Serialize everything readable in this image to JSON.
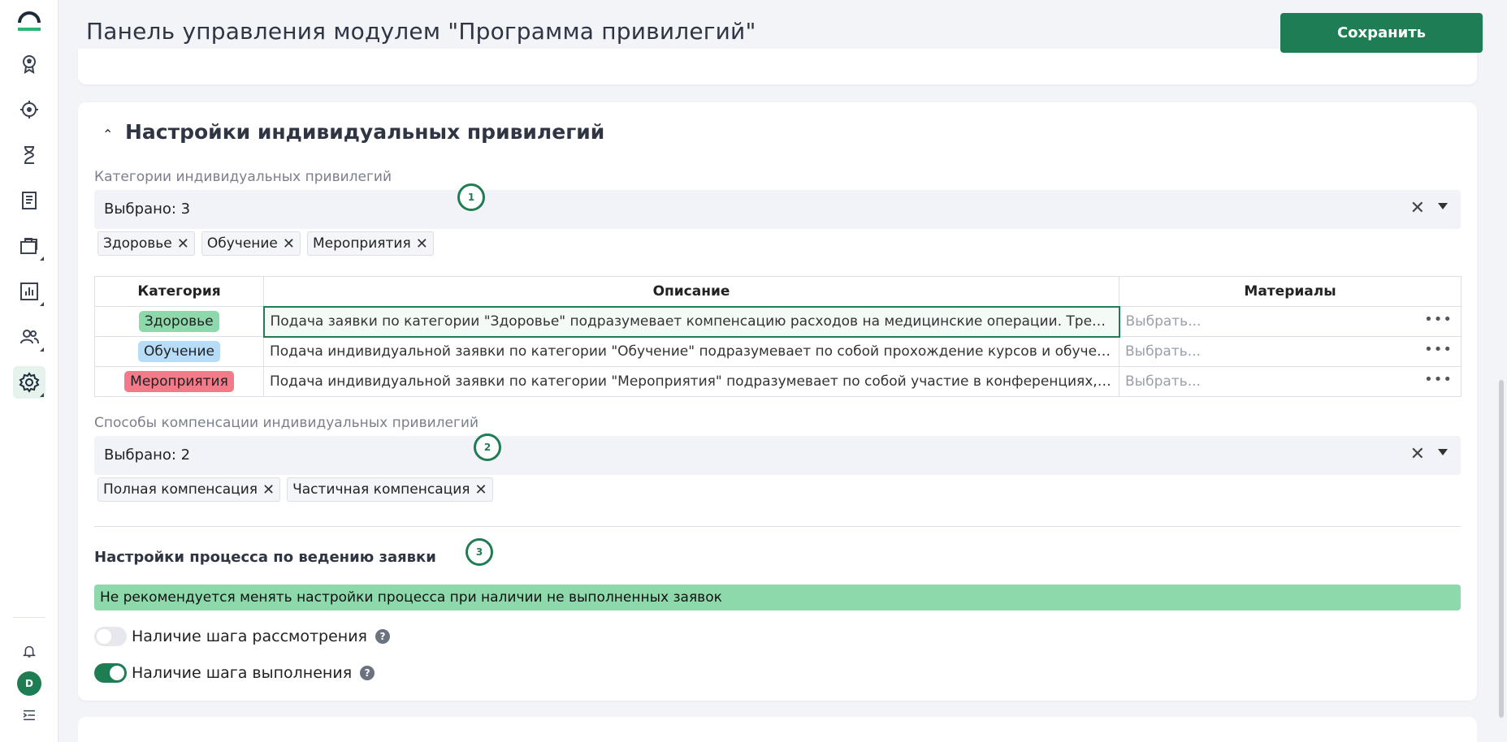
{
  "header": {
    "title": "Панель управления модулем \"Программа привилегий\"",
    "save_label": "Сохранить"
  },
  "sidebar": {
    "items": [
      {
        "icon": "award-icon"
      },
      {
        "icon": "target-icon"
      },
      {
        "icon": "hourglass-icon"
      },
      {
        "icon": "document-icon"
      },
      {
        "icon": "briefcase-icon"
      },
      {
        "icon": "chart-icon"
      },
      {
        "icon": "users-icon"
      },
      {
        "icon": "gear-icon",
        "active": true
      }
    ],
    "avatar_letter": "D"
  },
  "section": {
    "title": "Настройки индивидуальных привилегий",
    "categories": {
      "label": "Категории индивидуальных привилегий",
      "selected": "Выбрано: 3",
      "marker": "1",
      "chips": [
        "Здоровье",
        "Обучение",
        "Мероприятия"
      ]
    },
    "table": {
      "headers": [
        "Категория",
        "Описание",
        "Материалы"
      ],
      "rows": [
        {
          "category": "Здоровье",
          "color": "#8ed9ac",
          "description": "Подача заявки по категории \"Здоровье\" подразумевает компенсацию расходов на медицинские операции. Требуется предост…",
          "materials": "Выбрать..."
        },
        {
          "category": "Обучение",
          "color": "#b7dcf7",
          "description": "Подача индивидуальной заявки по категории \"Обучение\" подразумевает по собой прохождение курсов и обучения на тему, с…",
          "materials": "Выбрать..."
        },
        {
          "category": "Мероприятия",
          "color": "#f47a8a",
          "description": "Подача индивидуальной заявки по категории \"Мероприятия\" подразумевает по собой участие в конференциях, митапах на те…",
          "materials": "Выбрать..."
        }
      ]
    },
    "compensation": {
      "label": "Способы компенсации индивидуальных привилегий",
      "selected": "Выбрано: 2",
      "marker": "2",
      "chips": [
        "Полная компенсация",
        "Частичная компенсация"
      ]
    },
    "process": {
      "title": "Настройки процесса по ведению заявки",
      "marker": "3",
      "notice": "Не рекомендуется менять настройки процесса при наличии не выполненных заявок",
      "toggles": [
        {
          "label": "Наличие шага рассмотрения",
          "on": false
        },
        {
          "label": "Наличие шага выполнения",
          "on": true
        }
      ],
      "help": "?"
    }
  },
  "colors": {
    "accent": "#1f7d53"
  }
}
